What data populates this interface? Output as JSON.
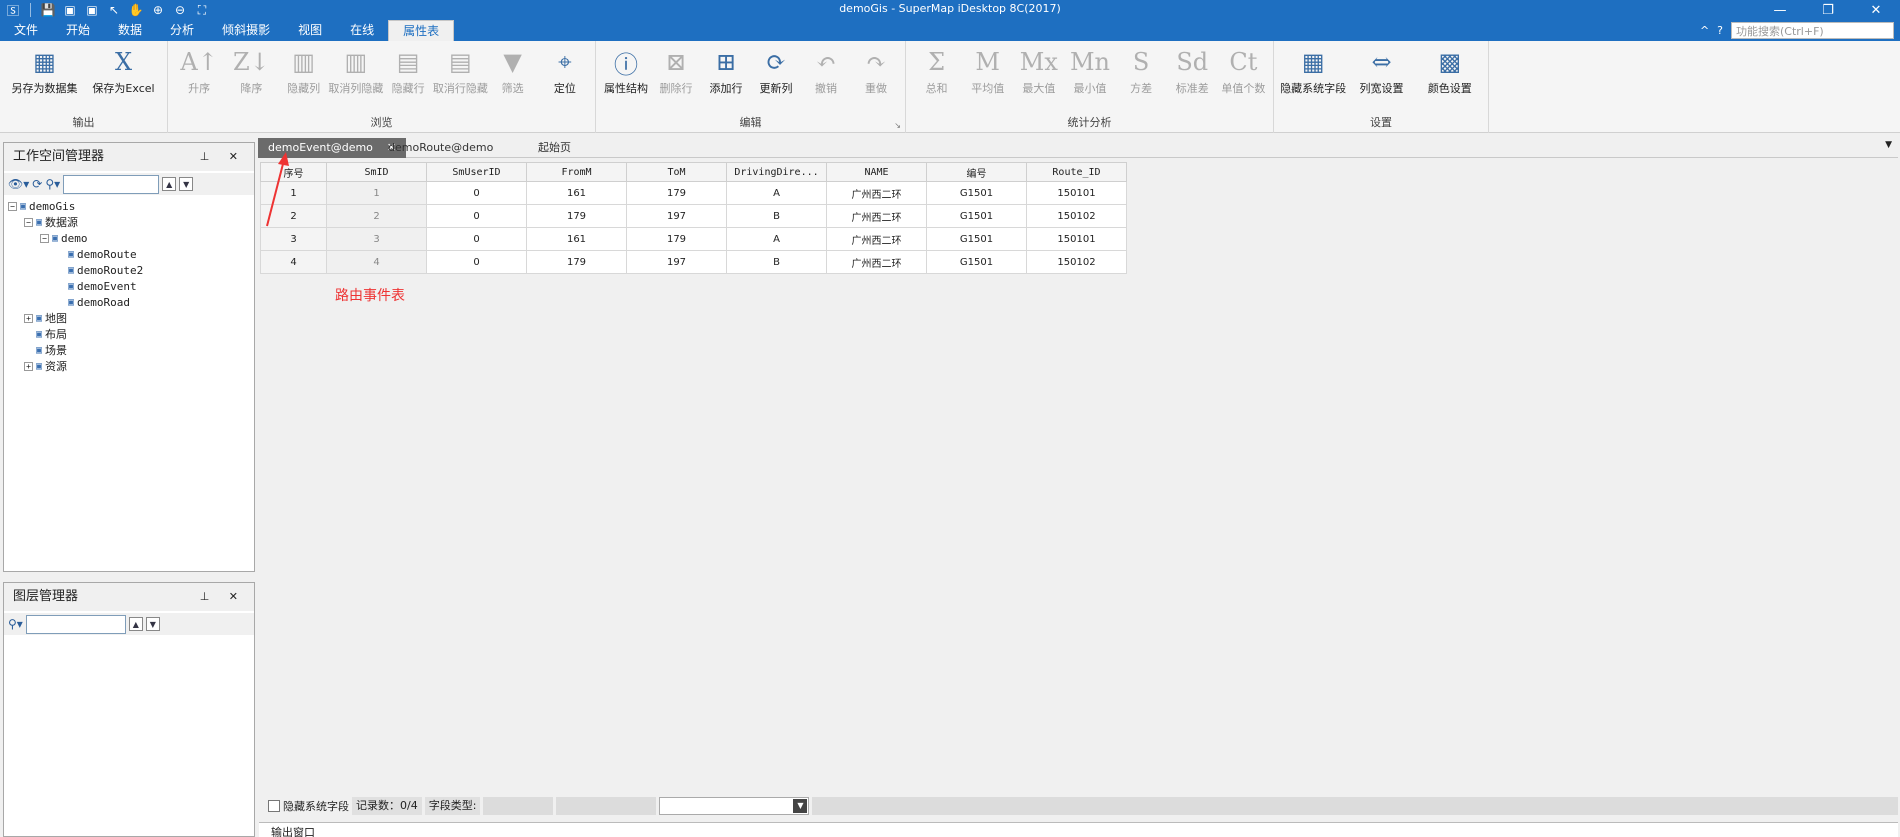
{
  "window": {
    "title": "demoGis - SuperMap iDesktop 8C(2017)",
    "controls": [
      "—",
      "❐",
      "✕"
    ]
  },
  "quick_access": [
    "🅂",
    "💾",
    "▣",
    "▣",
    "↖",
    "✋",
    "⊕",
    "⊖",
    "⛶"
  ],
  "menu": {
    "tabs": [
      "文件",
      "开始",
      "数据",
      "分析",
      "倾斜摄影",
      "视图",
      "在线",
      "属性表"
    ],
    "active_tab": "属性表",
    "search_placeholder": "功能搜索(Ctrl+F)",
    "right_symbols": [
      "^",
      "?"
    ]
  },
  "ribbon": {
    "groups": [
      {
        "label": "输出",
        "buttons": [
          {
            "label": "另存为数据集",
            "icon": "▦"
          },
          {
            "label": "保存为Excel",
            "icon": "X"
          }
        ]
      },
      {
        "label": "浏览",
        "buttons": [
          {
            "label": "升序",
            "icon": "A↑"
          },
          {
            "label": "降序",
            "icon": "Z↓"
          },
          {
            "label": "隐藏列",
            "icon": "▥"
          },
          {
            "label": "取消列隐藏",
            "icon": "▥"
          },
          {
            "label": "隐藏行",
            "icon": "▤"
          },
          {
            "label": "取消行隐藏",
            "icon": "▤"
          },
          {
            "label": "筛选",
            "icon": "▼"
          },
          {
            "label": "定位",
            "icon": "⌖"
          }
        ]
      },
      {
        "label": "编辑",
        "buttons": [
          {
            "label": "属性结构",
            "icon": "ⓘ"
          },
          {
            "label": "删除行",
            "icon": "⊠"
          },
          {
            "label": "添加行",
            "icon": "⊞"
          },
          {
            "label": "更新列",
            "icon": "⟳"
          },
          {
            "label": "撤销",
            "icon": "↶"
          },
          {
            "label": "重做",
            "icon": "↷"
          }
        ]
      },
      {
        "label": "统计分析",
        "buttons": [
          {
            "label": "总和",
            "icon": "Σ"
          },
          {
            "label": "平均值",
            "icon": "M"
          },
          {
            "label": "最大值",
            "icon": "Mx"
          },
          {
            "label": "最小值",
            "icon": "Mn"
          },
          {
            "label": "方差",
            "icon": "S"
          },
          {
            "label": "标准差",
            "icon": "Sd"
          },
          {
            "label": "单值个数",
            "icon": "Ct"
          }
        ]
      },
      {
        "label": "设置",
        "buttons": [
          {
            "label": "隐藏系统字段",
            "icon": "▦"
          },
          {
            "label": "列宽设置",
            "icon": "⇔"
          },
          {
            "label": "颜色设置",
            "icon": "▩"
          }
        ]
      }
    ]
  },
  "workspace_panel": {
    "title": "工作空间管理器",
    "controls": "⊥ ✕",
    "tree": [
      {
        "label": "demoGis",
        "level": 0,
        "expander": "−"
      },
      {
        "label": "数据源",
        "level": 1,
        "expander": "−"
      },
      {
        "label": "demo",
        "level": 2,
        "expander": "−"
      },
      {
        "label": "demoRoute",
        "level": 3,
        "expander": ""
      },
      {
        "label": "demoRoute2",
        "level": 3,
        "expander": ""
      },
      {
        "label": "demoEvent",
        "level": 3,
        "expander": ""
      },
      {
        "label": "demoRoad",
        "level": 3,
        "expander": ""
      },
      {
        "label": "地图",
        "level": 1,
        "expander": "+"
      },
      {
        "label": "布局",
        "level": 1,
        "expander": ""
      },
      {
        "label": "场景",
        "level": 1,
        "expander": ""
      },
      {
        "label": "资源",
        "level": 1,
        "expander": "+"
      }
    ]
  },
  "layer_panel": {
    "title": "图层管理器",
    "controls": "⊥ ✕"
  },
  "doc_tabs": [
    {
      "label": "demoEvent@demo",
      "active": true
    },
    {
      "label": "demoRoute@demo",
      "active": false
    },
    {
      "label": "起始页",
      "active": false
    }
  ],
  "table": {
    "columns": [
      "序号",
      "SmID",
      "SmUserID",
      "FromM",
      "ToM",
      "DrivingDire...",
      "NAME",
      "编号",
      "Route_ID"
    ],
    "rows": [
      [
        "1",
        "1",
        "0",
        "161",
        "179",
        "A",
        "广州西二环",
        "G1501",
        "150101"
      ],
      [
        "2",
        "2",
        "0",
        "179",
        "197",
        "B",
        "广州西二环",
        "G1501",
        "150102"
      ],
      [
        "3",
        "3",
        "0",
        "161",
        "179",
        "A",
        "广州西二环",
        "G1501",
        "150101"
      ],
      [
        "4",
        "4",
        "0",
        "179",
        "197",
        "B",
        "广州西二环",
        "G1501",
        "150102"
      ]
    ]
  },
  "annotation": "路由事件表",
  "status": {
    "hide_system_fields": "隐藏系统字段",
    "records": "记录数：0/4",
    "field_type": "字段类型:"
  },
  "output_panel": "输出窗口"
}
